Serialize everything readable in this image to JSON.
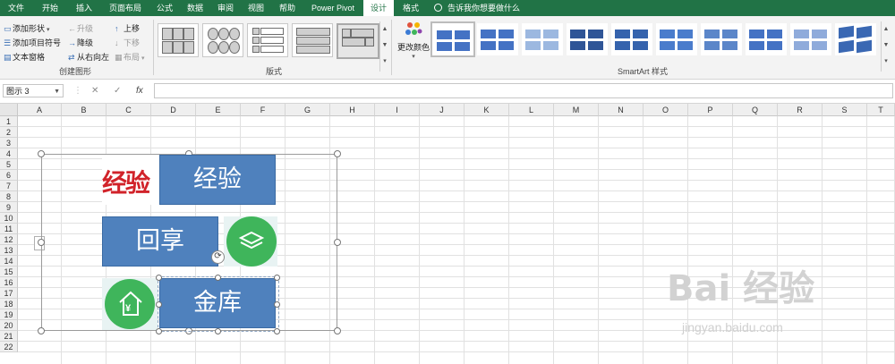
{
  "menu": {
    "items": [
      "文件",
      "开始",
      "插入",
      "页面布局",
      "公式",
      "数据",
      "审阅",
      "视图",
      "帮助",
      "Power Pivot",
      "设计",
      "格式"
    ],
    "active": "设计",
    "search_placeholder": "告诉我你想要做什么"
  },
  "ribbon": {
    "create_graphic": {
      "add_shape": "添加形状",
      "add_bullet": "添加项目符号",
      "text_pane": "文本窗格",
      "promote": "升级",
      "demote": "降级",
      "right_to_left": "从右向左",
      "move_up": "上移",
      "move_down": "下移",
      "layout": "布局",
      "label": "创建图形"
    },
    "layouts": {
      "label": "版式"
    },
    "styles": {
      "change_colors": "更改颜色",
      "label": "SmartArt 样式"
    }
  },
  "formula_bar": {
    "name_box": "图示 3",
    "cancel_icon": "✕",
    "enter_icon": "✓",
    "fx_icon": "fx",
    "value": ""
  },
  "sheet": {
    "columns": [
      "A",
      "B",
      "C",
      "D",
      "E",
      "F",
      "G",
      "H",
      "I",
      "J",
      "K",
      "L",
      "M",
      "N",
      "O",
      "P",
      "Q",
      "R",
      "S",
      "T"
    ],
    "rows": [
      "1",
      "2",
      "3",
      "4",
      "5",
      "6",
      "7",
      "8",
      "9",
      "10",
      "11",
      "12",
      "13",
      "14",
      "15",
      "16",
      "17",
      "18",
      "19",
      "20",
      "21",
      "22"
    ]
  },
  "smartart": {
    "shape1": "经验",
    "shape2": "回享",
    "shape3": "金库",
    "image_text": "经验",
    "currency_glyph": "¥"
  },
  "watermark": {
    "main": "Bai 经验",
    "sub": "jingyan.baidu.com"
  },
  "colors": {
    "excel_green": "#217346",
    "shape_blue": "#4f81bd",
    "icon_green": "#3fb55b",
    "logo_red": "#d1232a"
  }
}
